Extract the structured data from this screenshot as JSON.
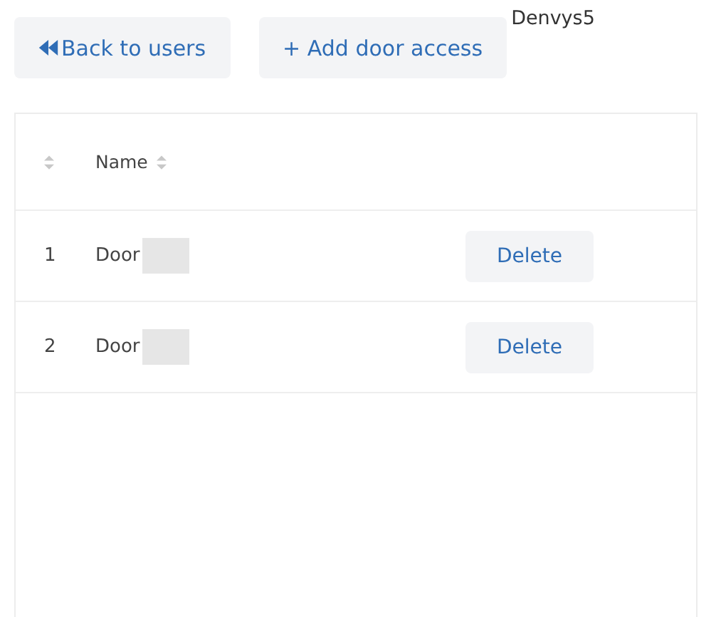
{
  "toolbar": {
    "buttons": [
      {
        "kind": "back",
        "label": "Back to users"
      },
      {
        "kind": "plain",
        "label": "+ Add door access"
      }
    ],
    "user_label": "Denvys5"
  },
  "table": {
    "columns": [
      {
        "sortable": true
      },
      {
        "label": "Name",
        "sortable": true
      },
      {}
    ],
    "rows": [
      {
        "index": "1",
        "name": "Door",
        "redacted": true,
        "action": "Delete"
      },
      {
        "index": "2",
        "name": "Door",
        "redacted": true,
        "action": "Delete"
      }
    ]
  }
}
